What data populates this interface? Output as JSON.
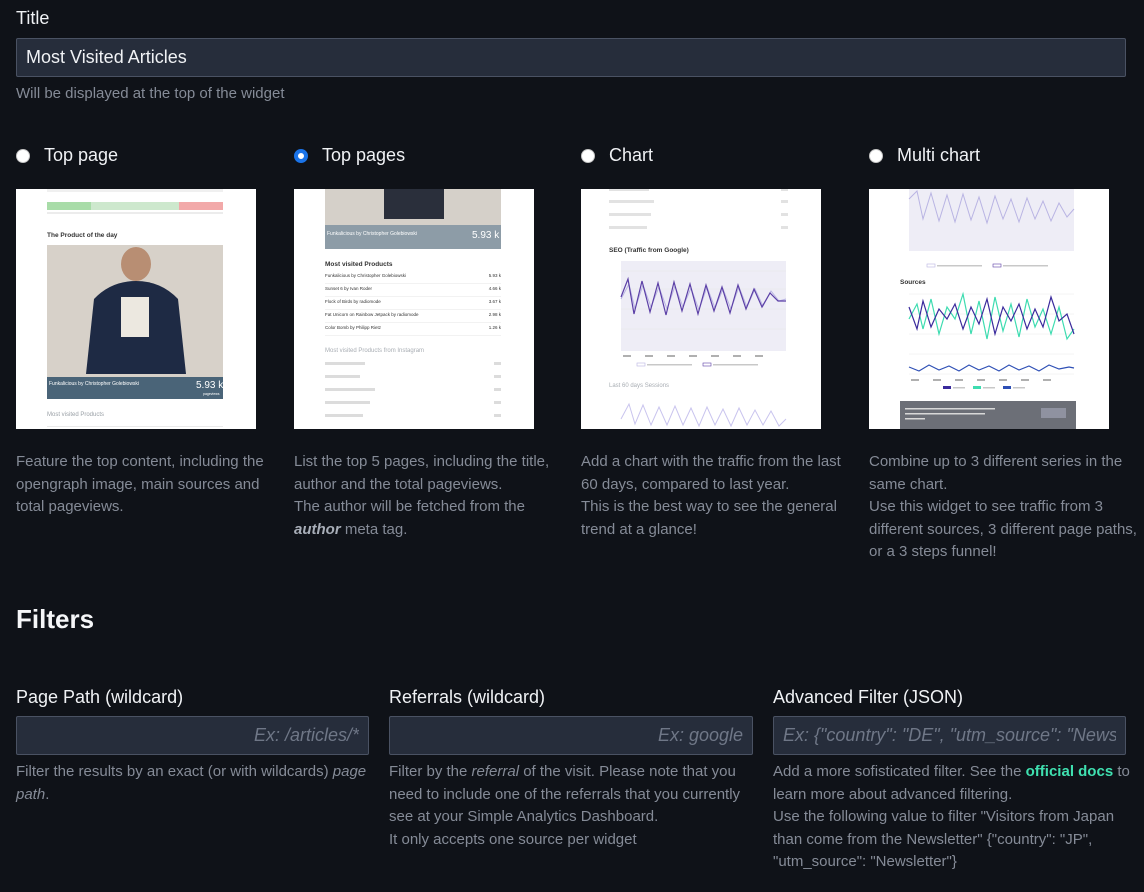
{
  "title_field": {
    "label": "Title",
    "value": "Most Visited Articles",
    "help": "Will be displayed at the top of the widget"
  },
  "widget_types": [
    {
      "label": "Top page",
      "checked": false,
      "description": "Feature the top content, including the opengraph image, main sources and total pageviews."
    },
    {
      "label": "Top pages",
      "checked": true,
      "description_1": "List the top 5 pages, including the title, author and the total pageviews.",
      "description_2_pre": "The author will be fetched from the ",
      "description_2_em": "author",
      "description_2_post": " meta tag."
    },
    {
      "label": "Chart",
      "checked": false,
      "description_1": "Add a chart with the traffic from the last 60 days, compared to last year.",
      "description_2": "This is the best way to see the general trend at a glance!"
    },
    {
      "label": "Multi chart",
      "checked": false,
      "description_1": "Combine up to 3 different series in the same chart.",
      "description_2": "Use this widget to see traffic from 3 different sources, 3 different page paths, or a 3 steps funnel!"
    }
  ],
  "thumbs": {
    "top_page": {
      "product_of_day": "The Product of the day",
      "caption": "Funkalicious by Christopher Golebiowski",
      "count": "5.93 k",
      "count_unit": "pageviews",
      "section": "Most visited Products"
    },
    "top_pages": {
      "caption": "Funkalicious by Christopher Golebiowski",
      "count": "5.93 k",
      "section": "Most visited Products",
      "items": [
        {
          "name": "Funkalicious by Christopher Golebiowski",
          "value": "5.93 k"
        },
        {
          "name": "Sunset 6 by Ivan Roder",
          "value": "4.66 k"
        },
        {
          "name": "Flock of Birds by radiomode",
          "value": "3.67 k"
        },
        {
          "name": "Fat Unicorn on Rainbow Jetpack by radiomode",
          "value": "2.98 k"
        },
        {
          "name": "Color Bomb by Philipp Rietz",
          "value": "1.26 k"
        }
      ],
      "section2": "Most visited Products from Instagram"
    },
    "chart": {
      "title": "SEO (Traffic from Google)",
      "section2": "Last 60 days Sessions"
    },
    "multi_chart": {
      "title": "Sources"
    }
  },
  "filters": {
    "heading": "Filters",
    "page_path": {
      "label": "Page Path (wildcard)",
      "placeholder": "Ex: /articles/*",
      "help_pre": "Filter the results by an exact (or with wildcards) ",
      "help_em": "page path",
      "help_post": "."
    },
    "referrals": {
      "label": "Referrals (wildcard)",
      "placeholder": "Ex: google",
      "help_pre": "Filter by the ",
      "help_em": "referral",
      "help_post": " of the visit. Please note that you need to include one of the referrals that you currently see at your Simple Analytics Dashboard.",
      "help_2": "It only accepts one source per widget"
    },
    "advanced": {
      "label": "Advanced Filter (JSON)",
      "placeholder": "Ex: {\"country\": \"DE\", \"utm_source\": \"Newsletter\"}",
      "help_pre": "Add a more sofisticated filter. See the ",
      "help_link": "official docs",
      "help_post": " to learn more about advanced filtering.",
      "help_2": "Use the following value to filter \"Visitors from Japan than come from the Newsletter\" {\"country\": \"JP\", \"utm_source\": \"Newsletter\"}"
    }
  }
}
